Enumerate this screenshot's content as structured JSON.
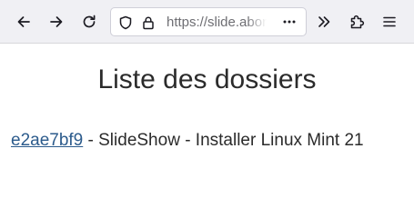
{
  "browser": {
    "url_text": "https://slide.abon",
    "icons": {
      "back": "arrow-left-icon",
      "forward": "arrow-right-icon",
      "reload": "reload-icon",
      "tracking": "shield-icon",
      "security": "lock-icon",
      "page_actions": "more-horizontal-icon",
      "overflow": "double-chevron-right-icon",
      "extensions": "puzzle-icon",
      "menu": "hamburger-menu-icon"
    },
    "colors": {
      "toolbar_bg": "#f0f0f4",
      "urlbar_border": "#cfcfd8"
    }
  },
  "page": {
    "title": "Liste des dossiers",
    "entries": [
      {
        "link": "e2ae7bf9",
        "description": " - SlideShow - Installer Linux Mint 21"
      }
    ],
    "colors": {
      "text": "#2b2b2b",
      "link": "#2c5b8c"
    }
  }
}
